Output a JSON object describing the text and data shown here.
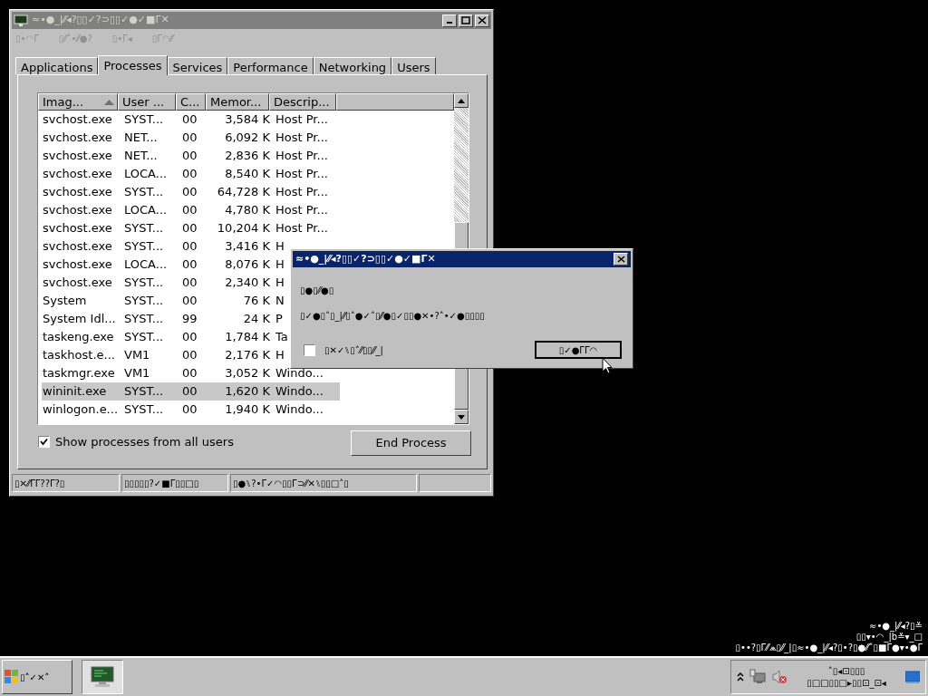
{
  "window": {
    "title": "≈•●_|⁄⁄◂?▯▯✓?⊃▯▯✓●✓■Γ✕"
  },
  "menu": [
    "▯•◠Γ",
    "▯⁄⁄˄•⁄⁄●?",
    "▯•Γ◂",
    "▯Γ◠⁄⁄"
  ],
  "tabs": [
    {
      "label": "Applications",
      "selected": false
    },
    {
      "label": "Processes",
      "selected": true
    },
    {
      "label": "Services",
      "selected": false
    },
    {
      "label": "Performance",
      "selected": false
    },
    {
      "label": "Networking",
      "selected": false
    },
    {
      "label": "Users",
      "selected": false
    }
  ],
  "table": {
    "columns": [
      {
        "label": "Imag...",
        "sorted": true
      },
      {
        "label": "User ...",
        "sorted": false
      },
      {
        "label": "C...",
        "sorted": false
      },
      {
        "label": "Memor...",
        "sorted": false
      },
      {
        "label": "Descrip...",
        "sorted": false
      }
    ],
    "rows": [
      {
        "cells": [
          "svchost.exe",
          "SYST...",
          "00",
          "3,584 K",
          "Host Pr..."
        ],
        "selected": false
      },
      {
        "cells": [
          "svchost.exe",
          "NET...",
          "00",
          "6,092 K",
          "Host Pr..."
        ],
        "selected": false
      },
      {
        "cells": [
          "svchost.exe",
          "NET...",
          "00",
          "2,836 K",
          "Host Pr..."
        ],
        "selected": false
      },
      {
        "cells": [
          "svchost.exe",
          "LOCA...",
          "00",
          "8,540 K",
          "Host Pr..."
        ],
        "selected": false
      },
      {
        "cells": [
          "svchost.exe",
          "SYST...",
          "00",
          "64,728 K",
          "Host Pr..."
        ],
        "selected": false
      },
      {
        "cells": [
          "svchost.exe",
          "LOCA...",
          "00",
          "4,780 K",
          "Host Pr..."
        ],
        "selected": false
      },
      {
        "cells": [
          "svchost.exe",
          "SYST...",
          "00",
          "10,204 K",
          "Host Pr..."
        ],
        "selected": false
      },
      {
        "cells": [
          "svchost.exe",
          "SYST...",
          "00",
          "3,416 K",
          "H"
        ],
        "selected": false
      },
      {
        "cells": [
          "svchost.exe",
          "LOCA...",
          "00",
          "8,076 K",
          "H"
        ],
        "selected": false
      },
      {
        "cells": [
          "svchost.exe",
          "SYST...",
          "00",
          "2,340 K",
          "H"
        ],
        "selected": false
      },
      {
        "cells": [
          "System",
          "SYST...",
          "00",
          "76 K",
          "N"
        ],
        "selected": false
      },
      {
        "cells": [
          "System Idl...",
          "SYST...",
          "99",
          "24 K",
          "P"
        ],
        "selected": false
      },
      {
        "cells": [
          "taskeng.exe",
          "SYST...",
          "00",
          "1,784 K",
          "Ta"
        ],
        "selected": false
      },
      {
        "cells": [
          "taskhost.e...",
          "VM1",
          "00",
          "2,176 K",
          "H"
        ],
        "selected": false
      },
      {
        "cells": [
          "taskmgr.exe",
          "VM1",
          "00",
          "3,052 K",
          "Windo..."
        ],
        "selected": false
      },
      {
        "cells": [
          "wininit.exe",
          "SYST...",
          "00",
          "1,620 K",
          "Windo..."
        ],
        "selected": true
      },
      {
        "cells": [
          "winlogon.e...",
          "SYST...",
          "00",
          "1,940 K",
          "Windo..."
        ],
        "selected": false
      }
    ]
  },
  "show_all_users": {
    "label": "Show processes from all users",
    "checked": true
  },
  "end_process_button": "End Process",
  "status_bar": [
    "▯✕⁄⁄ΓΓ??Γ?▯",
    "▯▯▯▯▯?✓■Γ▯▯□▯",
    "▯●⑊?•Γ✓◠▯▯Γ⊃⁄⁄✕⑊▯▯□˄▯"
  ],
  "dialog": {
    "title": "≈•●_|⁄⁄◂?▯▯✓?⊃▯▯✓●✓■Γ✕",
    "lines": [
      "▯●▯⁄⁄●▯",
      "▯✓●▯˄▯_|⁄⁄▯˄●✓˄▯⁄⁄●▯✓▯▯●✕•?˄•✓●▯▯▯▯"
    ],
    "checkbox": {
      "label": "▯✕✓⑊▯˄⁄⁄▯▯⁄⁄_|",
      "checked": false
    },
    "button": "▯✓●ΓΓ◠"
  },
  "desktop_text": [
    "≈•●_|⁄⁄◂?▯≚",
    "▯▯▾•◠_|b≚▾_□",
    "▯••?▯Γ⁄⁄⩕▯⁄⁄_|▯≈•●_|⁄⁄◂?▯•?▯●⁄⁄˄▯■Γ●▾•●Γ"
  ],
  "taskbar": {
    "start_button": "▯˄✓✕˄",
    "clock": [
      "˄▯◂⊡▯▯▯",
      "▯□□▯▯□▸▯▯⊡_⊡◂"
    ]
  }
}
